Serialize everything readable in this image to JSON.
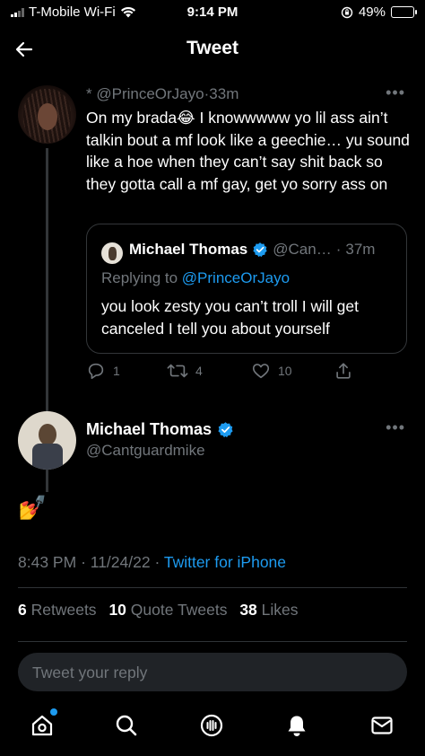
{
  "status_bar": {
    "carrier": "T-Mobile Wi-Fi",
    "time": "9:14 PM",
    "battery": "49%",
    "battery_level": 0.49,
    "icons": [
      "cellular-signal-icon",
      "wifi-icon",
      "orientation-lock-icon",
      "battery-icon"
    ]
  },
  "nav": {
    "title": "Tweet",
    "back_icon": "arrow-left-icon"
  },
  "parent_tweet": {
    "prefix": "*",
    "handle": "@PrinceOrJayo",
    "separator": "·",
    "time_ago": "33m",
    "text": "On my brada😂 I knowwwww yo lil ass ain’t talkin bout a mf look like a geechie… yu sound like a hoe when they can’t say shit back so they gotta call a mf gay, get yo sorry ass on",
    "more_icon": "more-icon",
    "quote": {
      "name": "Michael Thomas",
      "handle_truncated": "@Can…",
      "separator": "·",
      "time_ago": "37m",
      "replying_to_label": "Replying to",
      "replying_to_handle": "@PrinceOrJayo",
      "text": "you look zesty you can’t troll I will get canceled I tell you about yourself"
    },
    "actions": {
      "replies": "1",
      "retweets": "4",
      "likes": "10"
    }
  },
  "main_tweet": {
    "name": "Michael Thomas",
    "handle": "@Cantguardmike",
    "text": "💅",
    "time": "8:43 PM",
    "date": "11/24/22",
    "separator": "·",
    "source": "Twitter for iPhone",
    "stats": {
      "retweets_count": "6",
      "retweets_label": "Retweets",
      "quotes_count": "10",
      "quotes_label": "Quote Tweets",
      "likes_count": "38",
      "likes_label": "Likes"
    }
  },
  "reply": {
    "placeholder": "Tweet your reply"
  },
  "tab_bar": {
    "items": [
      "home-icon",
      "search-icon",
      "spaces-icon",
      "notifications-icon",
      "messages-icon"
    ]
  },
  "colors": {
    "background": "#000000",
    "accent": "#1d9bf0",
    "secondary_text": "#71767b",
    "divider": "#2f3336"
  }
}
